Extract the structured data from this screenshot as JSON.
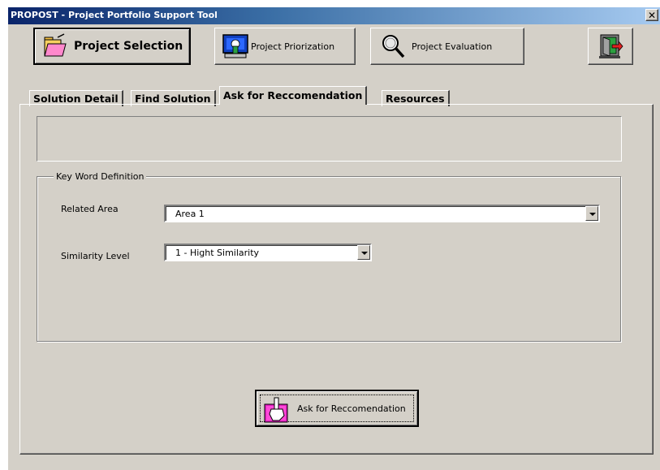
{
  "window": {
    "title": "PROPOST - Project Portfolio Support Tool",
    "close_glyph": "✕"
  },
  "toolbar": {
    "project_selection": {
      "label": "Project Selection",
      "icon": "folder-open-icon"
    },
    "project_priorization": {
      "label": "Project Priorization",
      "icon": "monitor-hand-icon"
    },
    "project_evaluation": {
      "label": "Project Evaluation",
      "icon": "magnifier-icon"
    },
    "exit": {
      "icon": "exit-door-icon"
    }
  },
  "tabs": [
    {
      "label": "Solution Detail",
      "active": false
    },
    {
      "label": "Find Solution",
      "active": false
    },
    {
      "label": "Ask for Reccomendation",
      "active": true
    },
    {
      "label": "Resources",
      "active": false
    }
  ],
  "keyword": {
    "legend": "Key Word Definition",
    "related_area_label": "Related Area",
    "related_area_value": "Area 1",
    "similarity_label": "Similarity Level",
    "similarity_value": "1 - Hight Similarity"
  },
  "ask_button": {
    "label": "Ask for Reccomendation",
    "icon": "hand-pink-icon"
  }
}
